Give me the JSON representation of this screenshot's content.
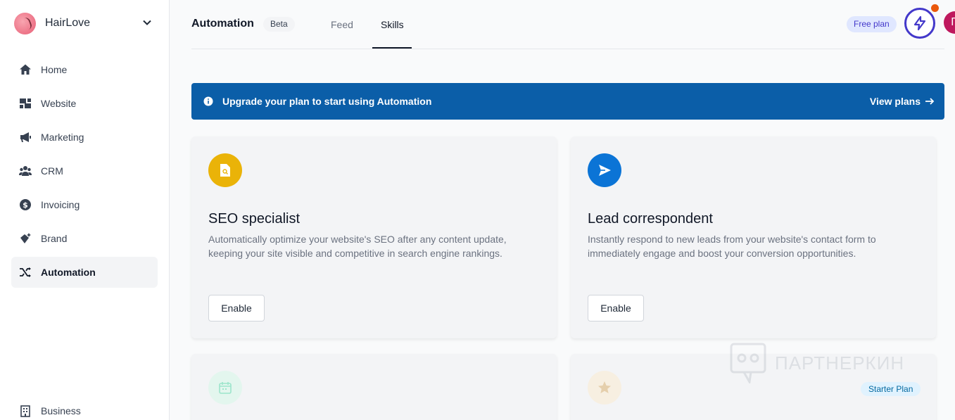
{
  "sidebar": {
    "brand_name": "HairLove",
    "items": [
      {
        "label": "Home",
        "icon": "home-icon"
      },
      {
        "label": "Website",
        "icon": "website-icon"
      },
      {
        "label": "Marketing",
        "icon": "megaphone-icon"
      },
      {
        "label": "CRM",
        "icon": "users-icon"
      },
      {
        "label": "Invoicing",
        "icon": "dollar-icon"
      },
      {
        "label": "Brand",
        "icon": "brand-icon"
      },
      {
        "label": "Automation",
        "icon": "shuffle-icon",
        "active": true
      }
    ],
    "bottom_item": {
      "label": "Business",
      "icon": "building-icon"
    }
  },
  "header": {
    "title": "Automation",
    "badge": "Beta",
    "tabs": [
      {
        "label": "Feed"
      },
      {
        "label": "Skills",
        "active": true
      }
    ],
    "plan_badge": "Free plan",
    "avatar_initial": "П"
  },
  "banner": {
    "text": "Upgrade your plan to start using Automation",
    "link": "View plans"
  },
  "cards": [
    {
      "title": "SEO specialist",
      "description": "Automatically optimize your website's SEO after any content update, keeping your site visible and competitive in search engine rankings.",
      "button": "Enable",
      "icon": "document-search-icon",
      "icon_color": "#eab308"
    },
    {
      "title": "Lead correspondent",
      "description": "Instantly respond to new leads from your website's contact form to immediately engage and boost your conversion opportunities.",
      "button": "Enable",
      "icon": "send-icon",
      "icon_color": "#0b74d6"
    },
    {
      "icon": "calendar-icon",
      "icon_color": "#a7e8c5"
    },
    {
      "icon": "star-icon",
      "icon_color": "#f5deb3",
      "badge": "Starter Plan"
    }
  ],
  "watermark": "ПАРТНЕРКИН",
  "colors": {
    "accent": "#4338ca",
    "banner": "#0b5ea8",
    "avatar": "#be185d"
  }
}
